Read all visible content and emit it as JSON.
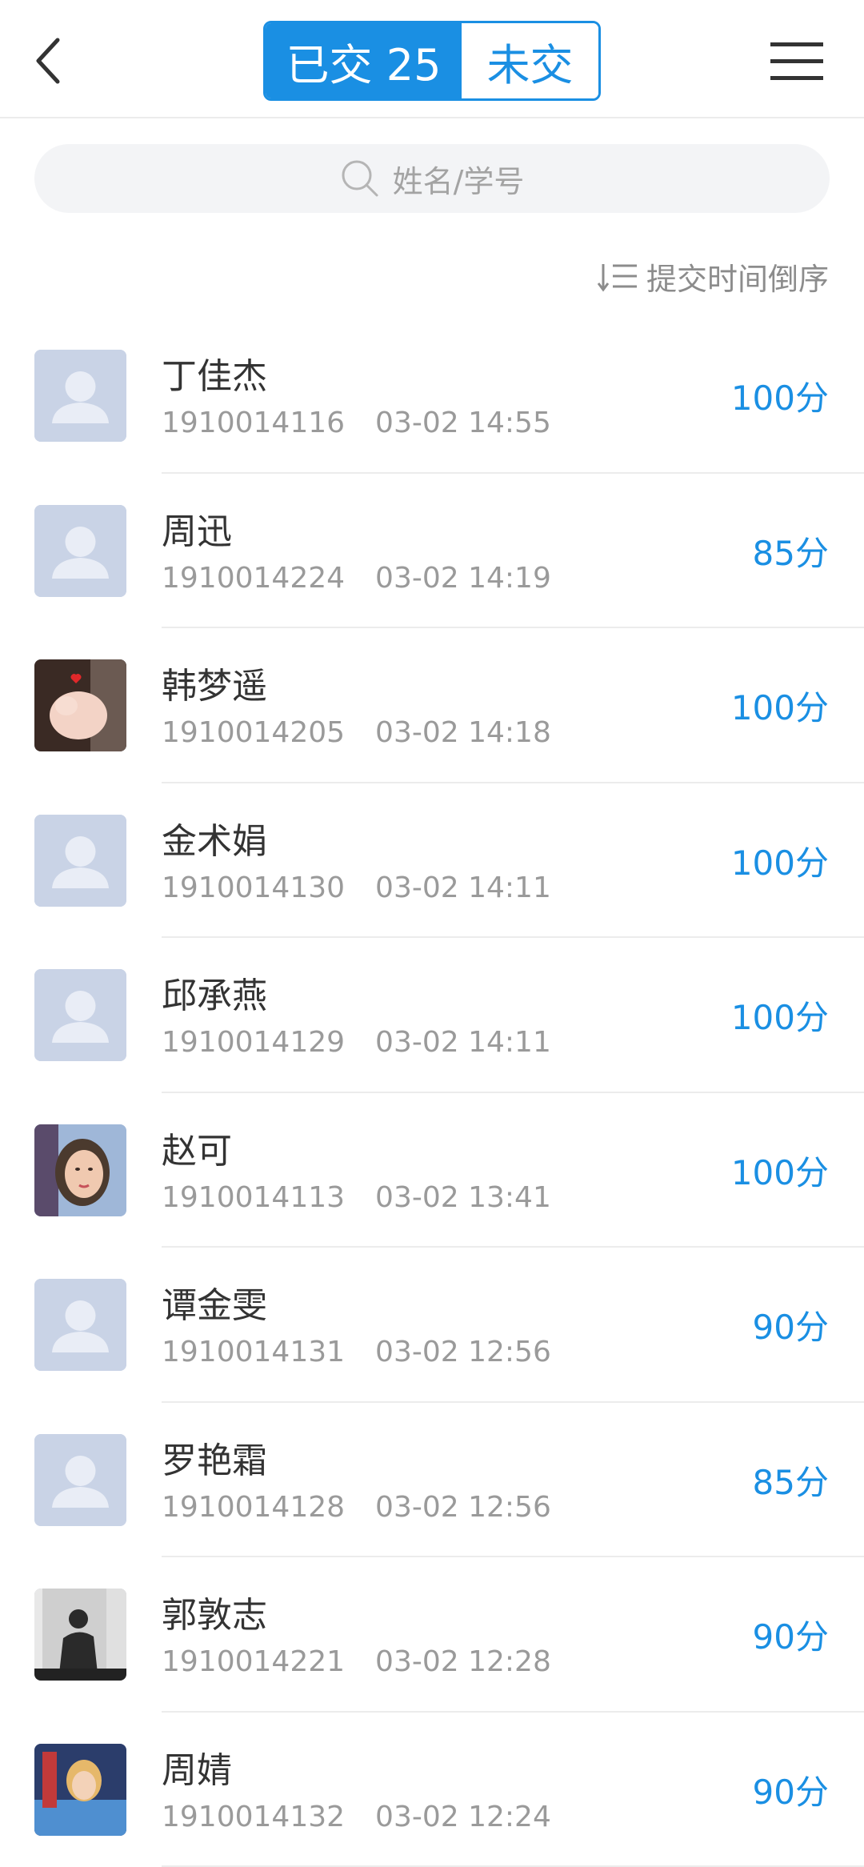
{
  "header": {
    "submitted_tab": "已交 25",
    "unsubmitted_tab": "未交"
  },
  "search": {
    "placeholder": "姓名/学号"
  },
  "sort": {
    "label": "提交时间倒序"
  },
  "colors": {
    "accent": "#1a8fe3",
    "placeholder_avatar": "#c9d3e6"
  },
  "students": [
    {
      "name": "丁佳杰",
      "id": "1910014116",
      "time": "03-02 14:55",
      "score": "100分",
      "avatar": "default"
    },
    {
      "name": "周迅",
      "id": "1910014224",
      "time": "03-02 14:19",
      "score": "85分",
      "avatar": "default"
    },
    {
      "name": "韩梦遥",
      "id": "1910014205",
      "time": "03-02 14:18",
      "score": "100分",
      "avatar": "photo-heart"
    },
    {
      "name": "金术娟",
      "id": "1910014130",
      "time": "03-02 14:11",
      "score": "100分",
      "avatar": "default"
    },
    {
      "name": "邱承燕",
      "id": "1910014129",
      "time": "03-02 14:11",
      "score": "100分",
      "avatar": "default"
    },
    {
      "name": "赵可",
      "id": "1910014113",
      "time": "03-02 13:41",
      "score": "100分",
      "avatar": "photo-woman"
    },
    {
      "name": "谭金雯",
      "id": "1910014131",
      "time": "03-02 12:56",
      "score": "90分",
      "avatar": "default"
    },
    {
      "name": "罗艳霜",
      "id": "1910014128",
      "time": "03-02 12:56",
      "score": "85分",
      "avatar": "default"
    },
    {
      "name": "郭敦志",
      "id": "1910014221",
      "time": "03-02 12:28",
      "score": "90分",
      "avatar": "photo-silhouette"
    },
    {
      "name": "周婧",
      "id": "1910014132",
      "time": "03-02 12:24",
      "score": "90分",
      "avatar": "photo-cartoon"
    }
  ]
}
